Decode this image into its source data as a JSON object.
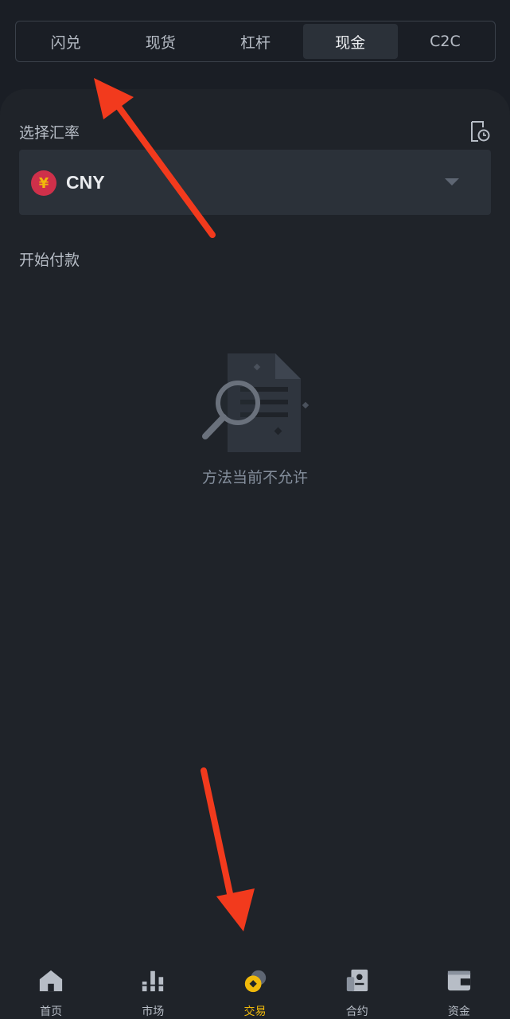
{
  "tabs": [
    {
      "label": "闪兑",
      "active": false
    },
    {
      "label": "现货",
      "active": false
    },
    {
      "label": "杠杆",
      "active": false
    },
    {
      "label": "现金",
      "active": true
    },
    {
      "label": "C2C",
      "active": false
    }
  ],
  "rate_section": {
    "label": "选择汇率",
    "currency_code": "CNY",
    "currency_symbol": "¥"
  },
  "payment_section": {
    "label": "开始付款"
  },
  "empty_state": {
    "message": "方法当前不允许"
  },
  "bottom_nav": {
    "items": [
      {
        "label": "首页",
        "icon": "home-icon"
      },
      {
        "label": "市场",
        "icon": "market-bars-icon"
      },
      {
        "label": "交易",
        "icon": "trade-coin-icon",
        "active": true
      },
      {
        "label": "合约",
        "icon": "contract-icon"
      },
      {
        "label": "资金",
        "icon": "wallet-icon"
      }
    ]
  },
  "colors": {
    "background": "#1a1e25",
    "panel": "#1f2329",
    "accent": "#f0b90b",
    "annotation_arrow": "#f23a1d"
  }
}
